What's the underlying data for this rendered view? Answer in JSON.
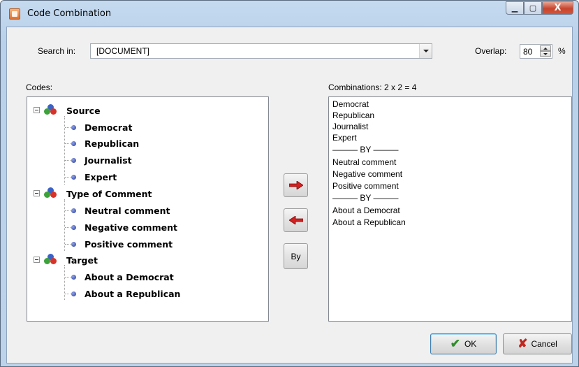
{
  "window": {
    "title": "Code Combination",
    "min_glyph": "▁",
    "max_glyph": "▢",
    "close_glyph": "X"
  },
  "search": {
    "label": "Search in:",
    "value": "[DOCUMENT]"
  },
  "overlap": {
    "label": "Overlap:",
    "value": "80",
    "unit": "%"
  },
  "codes": {
    "label": "Codes:",
    "groups": [
      {
        "label": "Source",
        "items": [
          "Democrat",
          "Republican",
          "Journalist",
          "Expert"
        ]
      },
      {
        "label": "Type of Comment",
        "items": [
          "Neutral comment",
          "Negative comment",
          "Positive comment"
        ]
      },
      {
        "label": "Target",
        "items": [
          "About a Democrat",
          "About a Republican"
        ]
      }
    ]
  },
  "actions": {
    "add_icon": "red-right-arrow",
    "remove_icon": "red-left-arrow",
    "by_label": "By"
  },
  "combinations": {
    "label": "Combinations:  2 x 2 = 4",
    "lines": [
      "Democrat",
      "Republican",
      "Journalist",
      "Expert",
      "——— BY ———",
      "Neutral comment",
      "Negative comment",
      "Positive comment",
      "——— BY ———",
      "About a Democrat",
      "About a Republican"
    ]
  },
  "footer": {
    "ok_label": "OK",
    "cancel_label": "Cancel"
  },
  "colors": {
    "accent_arrow": "#d42020",
    "ok_check": "#2f8d2a",
    "cancel_x": "#c0271e"
  }
}
